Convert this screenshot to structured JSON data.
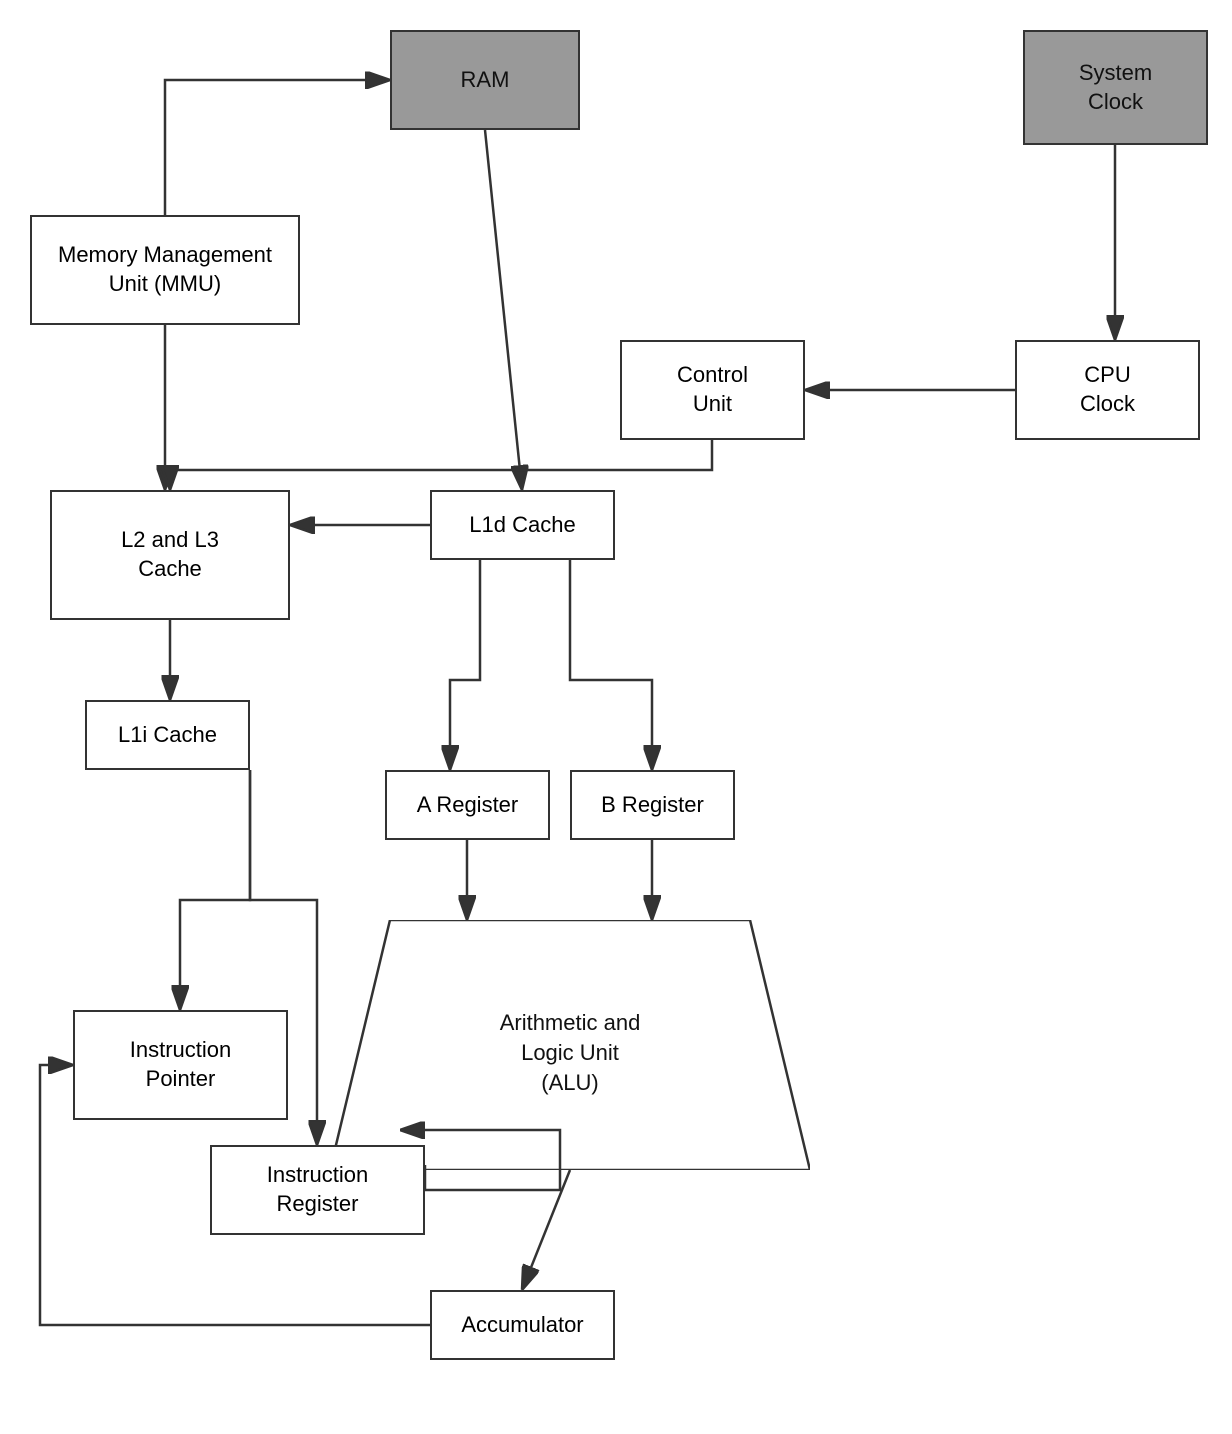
{
  "boxes": {
    "ram": {
      "label": "RAM",
      "dark": true
    },
    "system_clock": {
      "label": "System\nClock",
      "dark": true
    },
    "mmu": {
      "label": "Memory Management\nUnit (MMU)"
    },
    "control_unit": {
      "label": "Control\nUnit"
    },
    "cpu_clock": {
      "label": "CPU\nClock"
    },
    "l2l3": {
      "label": "L2 and L3\nCache"
    },
    "l1d": {
      "label": "L1d Cache"
    },
    "l1i": {
      "label": "L1i Cache"
    },
    "a_reg": {
      "label": "A Register"
    },
    "b_reg": {
      "label": "B Register"
    },
    "alu": {
      "label": "Arithmetic and\nLogic Unit\n(ALU)"
    },
    "instr_pointer": {
      "label": "Instruction\nPointer"
    },
    "instr_register": {
      "label": "Instruction\nRegister"
    },
    "accumulator": {
      "label": "Accumulator"
    }
  }
}
